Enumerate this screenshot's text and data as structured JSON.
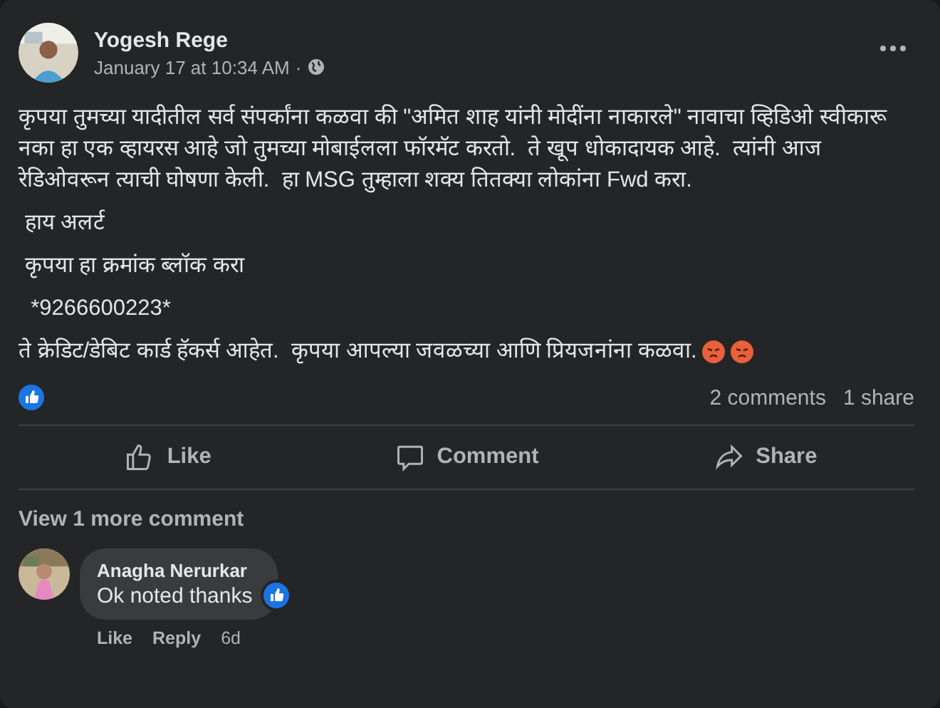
{
  "post": {
    "author": "Yogesh Rege",
    "timestamp": "January 17 at 10:34 AM",
    "separator": "·",
    "paragraphs": [
      "कृपया तुमच्या यादीतील सर्व संपर्कांना कळवा की \"अमित शाह यांनी मोदींना नाकारले\" नावाचा व्हिडिओ स्वीकारू नका हा एक व्हायरस आहे जो तुमच्या मोबाईलला फॉरमॅट करतो.  ते खूप धोकादायक आहे.  त्यांनी आज रेडिओवरून त्याची घोषणा केली.  हा MSG तुम्हाला शक्य तितक्या लोकांना Fwd करा.",
      " हाय अलर्ट",
      " कृपया हा क्रमांक ब्लॉक करा",
      "  *9266600223*",
      "ते क्रेडिट/डेबिट कार्ड हॅकर्स आहेत.  कृपया आपल्या जवळच्या आणि प्रियजनांना कळवा."
    ],
    "comments_count": "2 comments",
    "shares_count": "1 share"
  },
  "actions": [
    {
      "kind": "like",
      "label": "Like"
    },
    {
      "kind": "comment",
      "label": "Comment"
    },
    {
      "kind": "share",
      "label": "Share"
    }
  ],
  "view_more": "View 1 more comment",
  "comments": [
    {
      "author": "Anagha Nerurkar",
      "text": "Ok noted thanks",
      "liked": true,
      "actions": [
        "Like",
        "Reply"
      ],
      "age": "6d"
    }
  ]
}
